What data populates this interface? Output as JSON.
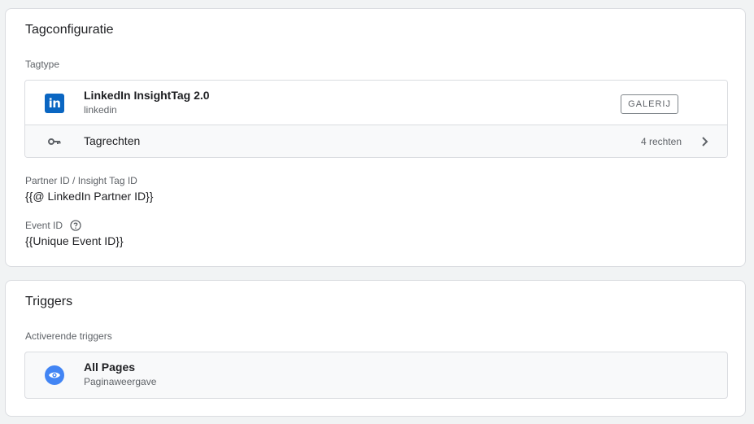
{
  "tag_config": {
    "title": "Tagconfiguratie",
    "tagtype_label": "Tagtype",
    "tag_type": {
      "name": "LinkedIn InsightTag 2.0",
      "vendor": "linkedin",
      "logo_text": "in",
      "gallery_button": "GALERIJ"
    },
    "permissions": {
      "label": "Tagrechten",
      "count": "4 rechten"
    },
    "fields": [
      {
        "label": "Partner ID / Insight Tag ID",
        "value": "{{@ LinkedIn Partner ID}}"
      },
      {
        "label": "Event ID",
        "value": "{{Unique Event ID}}"
      }
    ]
  },
  "triggers": {
    "title": "Triggers",
    "section_label": "Activerende triggers",
    "items": [
      {
        "name": "All Pages",
        "type": "Paginaweergave"
      }
    ]
  },
  "colors": {
    "linkedin_blue": "#0a66c2",
    "trigger_blue": "#4285f4",
    "border": "#dadce0",
    "muted_text": "#5f6368"
  },
  "icons": {
    "key": "key-icon",
    "chevron": "chevron-right-icon",
    "help": "help-circle-icon",
    "eye": "eye-icon"
  }
}
